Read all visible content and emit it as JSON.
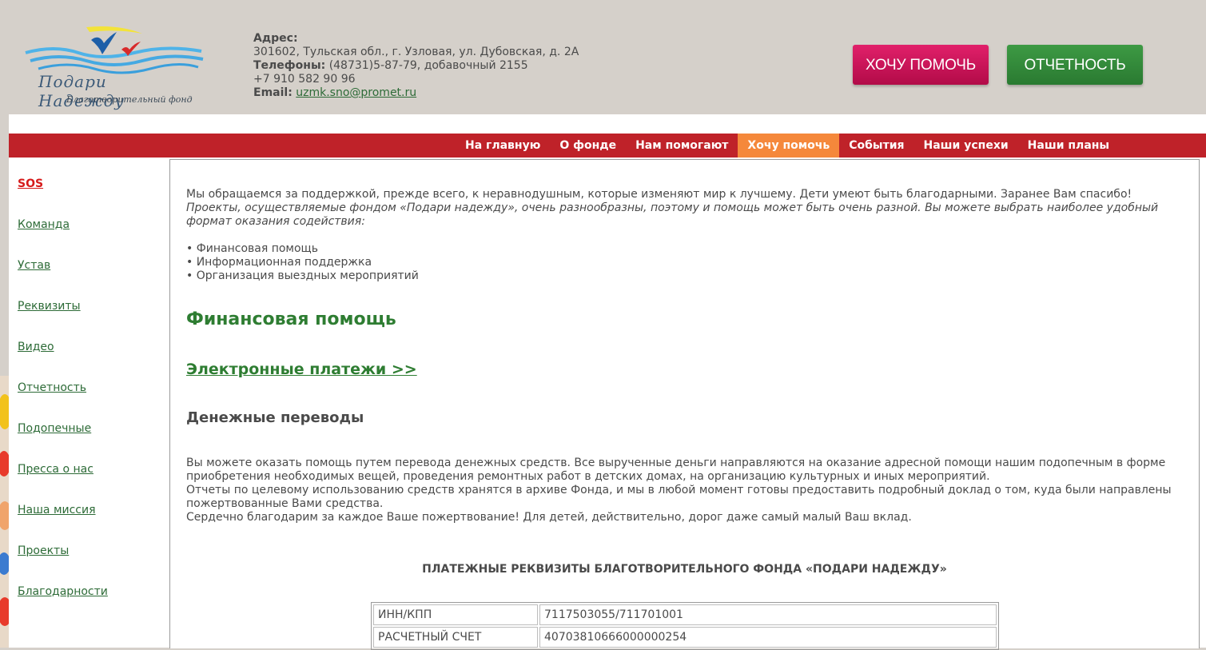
{
  "header": {
    "logo_title": "Подари Надежду",
    "logo_subtitle": "Благотворительный фонд",
    "address_label": "Адрес:",
    "address": "301602, Тульская обл., г. Узловая, ул. Дубовская, д. 2А",
    "phones_label": "Телефоны:",
    "phone1": "(48731)5-87-79, добавочный 2155",
    "phone2": "+7 910 582 90 96",
    "email_label": "Email:",
    "email": "uzmk.sno@promet.ru",
    "help_button": "ХОЧУ ПОМОЧЬ",
    "report_button": "ОТЧЕТНОСТЬ"
  },
  "nav": {
    "items": [
      {
        "label": "На главную"
      },
      {
        "label": "О фонде"
      },
      {
        "label": "Нам помогают"
      },
      {
        "label": "Хочу помочь",
        "active": true
      },
      {
        "label": "События"
      },
      {
        "label": "Наши успехи"
      },
      {
        "label": "Наши планы"
      }
    ]
  },
  "sidebar": {
    "items": [
      {
        "label": "SOS"
      },
      {
        "label": "Команда"
      },
      {
        "label": "Устав"
      },
      {
        "label": "Реквизиты"
      },
      {
        "label": "Видео"
      },
      {
        "label": "Отчетность"
      },
      {
        "label": "Подопечные"
      },
      {
        "label": "Пресса о нас"
      },
      {
        "label": "Наша миссия"
      },
      {
        "label": "Проекты"
      },
      {
        "label": "Благодарности"
      }
    ]
  },
  "content": {
    "intro": "Мы обращаемся за поддержкой, прежде всего, к неравнодушным, которые изменяют мир к лучшему. Дети умеют быть благодарными. Заранее Вам спасибо!",
    "intro_italic": "Проекты, осуществляемые фондом «Подари надежду», очень разнообразны, поэтому и помощь может быть очень разной. Вы можете выбрать наиболее удобный формат оказания содействия:",
    "bullets": [
      "• Финансовая помощь",
      "• Информационная поддержка",
      "• Организация выездных мероприятий"
    ],
    "heading_financial": "Финансовая помощь",
    "heading_epay": "Электронные платежи >>",
    "heading_transfer": "Денежные переводы",
    "transfer_text_1": "Вы можете оказать помощь путем перевода денежных средств. Все вырученные деньги направляются на оказание адресной помощи нашим подопечным в форме приобретения необходимых вещей, проведения ремонтных работ в детских домах, на организацию культурных и иных мероприятий.",
    "transfer_text_2": "Отчеты по целевому использованию средств хранятся в архиве Фонда, и мы в любой момент готовы предоставить подробный доклад о том, куда были направлены пожертвованные Вами средства.",
    "transfer_text_3": "Сердечно благодарим за каждое Ваше пожертвование! Для детей, действительно, дорог даже самый малый Ваш вклад.",
    "requisites_title": "ПЛАТЕЖНЫЕ РЕКВИЗИТЫ БЛАГОТВОРИТЕЛЬНОГО ФОНДА «ПОДАРИ НАДЕЖДУ»",
    "requisites": [
      {
        "key": "ИНН/КПП",
        "value": "7117503055/711701001"
      },
      {
        "key": "РАСЧЕТНЫЙ СЧЕТ",
        "value": "40703810666000000254"
      }
    ]
  },
  "colors": {
    "nav_bg": "#bf2229",
    "nav_active": "#f5883b",
    "link_green": "#2d6b37",
    "heading_green": "#2e7d32",
    "help_button": "#d0155a",
    "report_button": "#348b3a"
  }
}
